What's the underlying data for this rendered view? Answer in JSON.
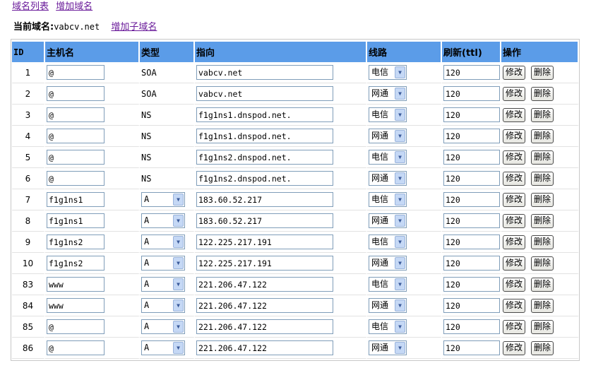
{
  "nav": {
    "domain_list": "域名列表",
    "add_domain": "增加域名"
  },
  "current": {
    "label": "当前域名:",
    "domain": "vabcv.net",
    "add_sub": "增加子域名"
  },
  "table": {
    "headers": [
      "ID",
      "主机名",
      "类型",
      "指向",
      "线路",
      "刷新(ttl)",
      "操作"
    ],
    "edit_label": "修改",
    "delete_label": "删除",
    "rows": [
      {
        "id": "1",
        "host": "@",
        "type": "SOA",
        "type_select": false,
        "value": "vabcv.net",
        "line": "电信",
        "ttl": "120"
      },
      {
        "id": "2",
        "host": "@",
        "type": "SOA",
        "type_select": false,
        "value": "vabcv.net",
        "line": "网通",
        "ttl": "120"
      },
      {
        "id": "3",
        "host": "@",
        "type": "NS",
        "type_select": false,
        "value": "f1g1ns1.dnspod.net.",
        "line": "电信",
        "ttl": "120"
      },
      {
        "id": "4",
        "host": "@",
        "type": "NS",
        "type_select": false,
        "value": "f1g1ns1.dnspod.net.",
        "line": "网通",
        "ttl": "120"
      },
      {
        "id": "5",
        "host": "@",
        "type": "NS",
        "type_select": false,
        "value": "f1g1ns2.dnspod.net.",
        "line": "电信",
        "ttl": "120"
      },
      {
        "id": "6",
        "host": "@",
        "type": "NS",
        "type_select": false,
        "value": "f1g1ns2.dnspod.net.",
        "line": "网通",
        "ttl": "120"
      },
      {
        "id": "7",
        "host": "f1g1ns1",
        "type": "A",
        "type_select": true,
        "value": "183.60.52.217",
        "line": "电信",
        "ttl": "120"
      },
      {
        "id": "8",
        "host": "f1g1ns1",
        "type": "A",
        "type_select": true,
        "value": "183.60.52.217",
        "line": "网通",
        "ttl": "120"
      },
      {
        "id": "9",
        "host": "f1g1ns2",
        "type": "A",
        "type_select": true,
        "value": "122.225.217.191",
        "line": "电信",
        "ttl": "120"
      },
      {
        "id": "10",
        "host": "f1g1ns2",
        "type": "A",
        "type_select": true,
        "value": "122.225.217.191",
        "line": "网通",
        "ttl": "120"
      },
      {
        "id": "83",
        "host": "www",
        "type": "A",
        "type_select": true,
        "value": "221.206.47.122",
        "line": "电信",
        "ttl": "120"
      },
      {
        "id": "84",
        "host": "www",
        "type": "A",
        "type_select": true,
        "value": "221.206.47.122",
        "line": "网通",
        "ttl": "120"
      },
      {
        "id": "85",
        "host": "@",
        "type": "A",
        "type_select": true,
        "value": "221.206.47.122",
        "line": "电信",
        "ttl": "120"
      },
      {
        "id": "86",
        "host": "@",
        "type": "A",
        "type_select": true,
        "value": "221.206.47.122",
        "line": "网通",
        "ttl": "120"
      }
    ]
  },
  "colors": {
    "header_bg": "#5b9ce8",
    "link": "#6a1b9a"
  },
  "icons": {
    "dropdown": "chevron-down-icon"
  }
}
